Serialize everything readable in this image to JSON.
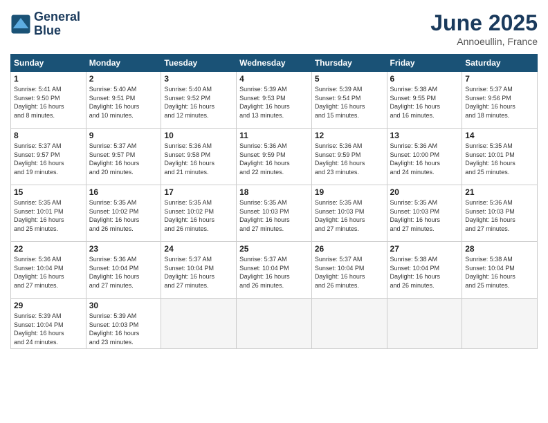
{
  "logo": {
    "line1": "General",
    "line2": "Blue"
  },
  "title": "June 2025",
  "location": "Annoeullin, France",
  "days_header": [
    "Sunday",
    "Monday",
    "Tuesday",
    "Wednesday",
    "Thursday",
    "Friday",
    "Saturday"
  ],
  "weeks": [
    [
      {
        "day": "1",
        "info": "Sunrise: 5:41 AM\nSunset: 9:50 PM\nDaylight: 16 hours\nand 8 minutes."
      },
      {
        "day": "2",
        "info": "Sunrise: 5:40 AM\nSunset: 9:51 PM\nDaylight: 16 hours\nand 10 minutes."
      },
      {
        "day": "3",
        "info": "Sunrise: 5:40 AM\nSunset: 9:52 PM\nDaylight: 16 hours\nand 12 minutes."
      },
      {
        "day": "4",
        "info": "Sunrise: 5:39 AM\nSunset: 9:53 PM\nDaylight: 16 hours\nand 13 minutes."
      },
      {
        "day": "5",
        "info": "Sunrise: 5:39 AM\nSunset: 9:54 PM\nDaylight: 16 hours\nand 15 minutes."
      },
      {
        "day": "6",
        "info": "Sunrise: 5:38 AM\nSunset: 9:55 PM\nDaylight: 16 hours\nand 16 minutes."
      },
      {
        "day": "7",
        "info": "Sunrise: 5:37 AM\nSunset: 9:56 PM\nDaylight: 16 hours\nand 18 minutes."
      }
    ],
    [
      {
        "day": "8",
        "info": "Sunrise: 5:37 AM\nSunset: 9:57 PM\nDaylight: 16 hours\nand 19 minutes."
      },
      {
        "day": "9",
        "info": "Sunrise: 5:37 AM\nSunset: 9:57 PM\nDaylight: 16 hours\nand 20 minutes."
      },
      {
        "day": "10",
        "info": "Sunrise: 5:36 AM\nSunset: 9:58 PM\nDaylight: 16 hours\nand 21 minutes."
      },
      {
        "day": "11",
        "info": "Sunrise: 5:36 AM\nSunset: 9:59 PM\nDaylight: 16 hours\nand 22 minutes."
      },
      {
        "day": "12",
        "info": "Sunrise: 5:36 AM\nSunset: 9:59 PM\nDaylight: 16 hours\nand 23 minutes."
      },
      {
        "day": "13",
        "info": "Sunrise: 5:36 AM\nSunset: 10:00 PM\nDaylight: 16 hours\nand 24 minutes."
      },
      {
        "day": "14",
        "info": "Sunrise: 5:35 AM\nSunset: 10:01 PM\nDaylight: 16 hours\nand 25 minutes."
      }
    ],
    [
      {
        "day": "15",
        "info": "Sunrise: 5:35 AM\nSunset: 10:01 PM\nDaylight: 16 hours\nand 25 minutes."
      },
      {
        "day": "16",
        "info": "Sunrise: 5:35 AM\nSunset: 10:02 PM\nDaylight: 16 hours\nand 26 minutes."
      },
      {
        "day": "17",
        "info": "Sunrise: 5:35 AM\nSunset: 10:02 PM\nDaylight: 16 hours\nand 26 minutes."
      },
      {
        "day": "18",
        "info": "Sunrise: 5:35 AM\nSunset: 10:03 PM\nDaylight: 16 hours\nand 27 minutes."
      },
      {
        "day": "19",
        "info": "Sunrise: 5:35 AM\nSunset: 10:03 PM\nDaylight: 16 hours\nand 27 minutes."
      },
      {
        "day": "20",
        "info": "Sunrise: 5:35 AM\nSunset: 10:03 PM\nDaylight: 16 hours\nand 27 minutes."
      },
      {
        "day": "21",
        "info": "Sunrise: 5:36 AM\nSunset: 10:03 PM\nDaylight: 16 hours\nand 27 minutes."
      }
    ],
    [
      {
        "day": "22",
        "info": "Sunrise: 5:36 AM\nSunset: 10:04 PM\nDaylight: 16 hours\nand 27 minutes."
      },
      {
        "day": "23",
        "info": "Sunrise: 5:36 AM\nSunset: 10:04 PM\nDaylight: 16 hours\nand 27 minutes."
      },
      {
        "day": "24",
        "info": "Sunrise: 5:37 AM\nSunset: 10:04 PM\nDaylight: 16 hours\nand 27 minutes."
      },
      {
        "day": "25",
        "info": "Sunrise: 5:37 AM\nSunset: 10:04 PM\nDaylight: 16 hours\nand 26 minutes."
      },
      {
        "day": "26",
        "info": "Sunrise: 5:37 AM\nSunset: 10:04 PM\nDaylight: 16 hours\nand 26 minutes."
      },
      {
        "day": "27",
        "info": "Sunrise: 5:38 AM\nSunset: 10:04 PM\nDaylight: 16 hours\nand 26 minutes."
      },
      {
        "day": "28",
        "info": "Sunrise: 5:38 AM\nSunset: 10:04 PM\nDaylight: 16 hours\nand 25 minutes."
      }
    ],
    [
      {
        "day": "29",
        "info": "Sunrise: 5:39 AM\nSunset: 10:04 PM\nDaylight: 16 hours\nand 24 minutes."
      },
      {
        "day": "30",
        "info": "Sunrise: 5:39 AM\nSunset: 10:03 PM\nDaylight: 16 hours\nand 23 minutes."
      },
      {
        "day": "",
        "info": ""
      },
      {
        "day": "",
        "info": ""
      },
      {
        "day": "",
        "info": ""
      },
      {
        "day": "",
        "info": ""
      },
      {
        "day": "",
        "info": ""
      }
    ]
  ]
}
